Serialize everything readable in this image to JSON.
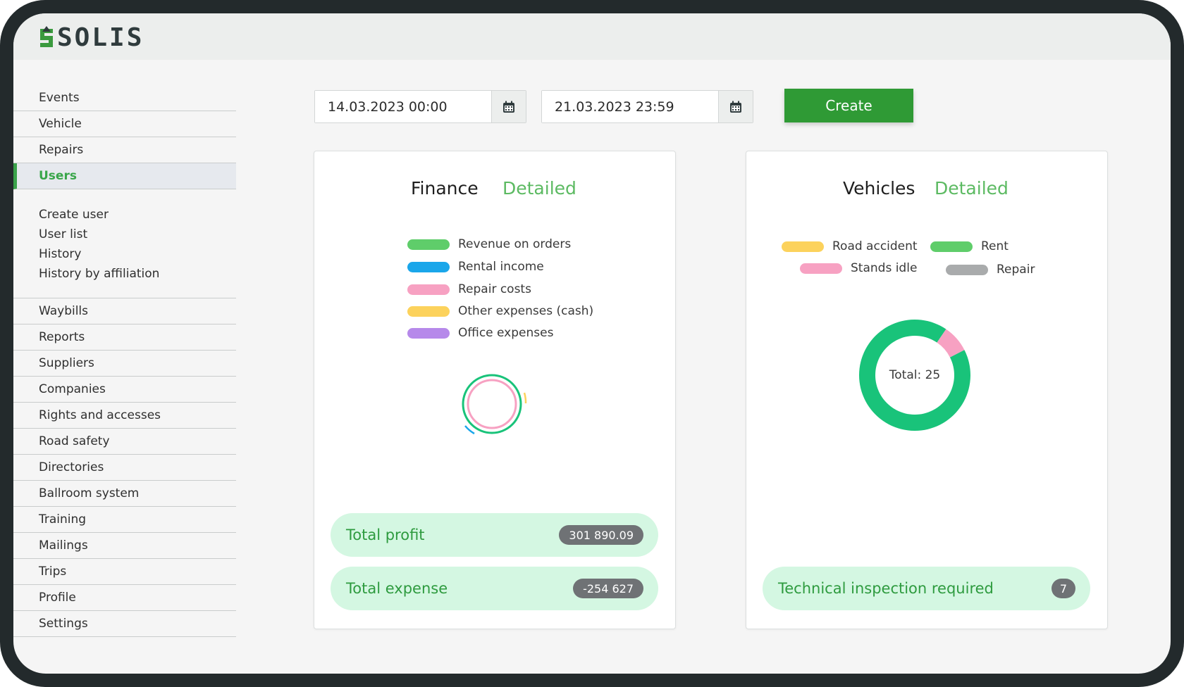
{
  "app": {
    "logo": "SOLIS"
  },
  "sidebar": {
    "top_items": [
      {
        "label": "Events"
      },
      {
        "label": "Vehicle"
      },
      {
        "label": "Repairs"
      },
      {
        "label": "Users",
        "active": true
      }
    ],
    "sub_items": [
      {
        "label": "Create user"
      },
      {
        "label": "User list"
      },
      {
        "label": "History"
      },
      {
        "label": "History by affiliation"
      }
    ],
    "bottom_items": [
      {
        "label": "Waybills"
      },
      {
        "label": "Reports"
      },
      {
        "label": "Suppliers"
      },
      {
        "label": "Companies"
      },
      {
        "label": "Rights and accesses"
      },
      {
        "label": "Road safety"
      },
      {
        "label": "Directories"
      },
      {
        "label": "Ballroom system"
      },
      {
        "label": "Training"
      },
      {
        "label": "Mailings"
      },
      {
        "label": "Trips"
      },
      {
        "label": "Profile"
      },
      {
        "label": "Settings"
      }
    ]
  },
  "filters": {
    "date_from": "14.03.2023 00:00",
    "date_to": "21.03.2023 23:59",
    "calendar_icon": "calendar-icon",
    "create_label": "Create"
  },
  "finance": {
    "title": "Finance",
    "link": "Detailed",
    "legend": [
      {
        "label": "Revenue on orders",
        "color": "#5fcd6a"
      },
      {
        "label": "Rental income",
        "color": "#1aa6ea"
      },
      {
        "label": "Repair costs",
        "color": "#f7a1c2"
      },
      {
        "label": "Other expenses (cash)",
        "color": "#fcd25c"
      },
      {
        "label": "Office expenses",
        "color": "#b689ea"
      }
    ],
    "total_profit_label": "Total profit",
    "total_profit_value": "301 890.09",
    "total_expense_label": "Total expense",
    "total_expense_value": "-254 627"
  },
  "vehicles": {
    "title": "Vehicles",
    "link": "Detailed",
    "legend": [
      {
        "label": "Road accident",
        "color": "#fcd25c"
      },
      {
        "label": "Rent",
        "color": "#5fcd6a"
      },
      {
        "label": "Stands idle",
        "color": "#f7a1c2"
      },
      {
        "label": "Repair",
        "color": "#a9abac"
      }
    ],
    "total_label": "Total: 25",
    "inspection_label": "Technical inspection required",
    "inspection_count": "7"
  },
  "chart_data": [
    {
      "type": "pie",
      "series": [
        {
          "values": []
        }
      ]
    },
    {
      "type": "pie",
      "categories": [
        "Rent",
        "Stands idle"
      ],
      "values": [
        23,
        2
      ]
    }
  ]
}
